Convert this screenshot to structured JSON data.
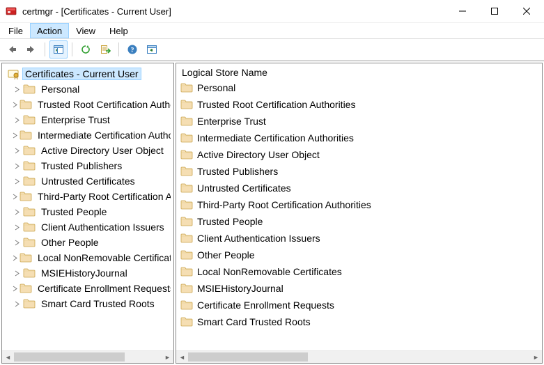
{
  "title": "certmgr - [Certificates - Current User]",
  "menu": {
    "file": "File",
    "action": "Action",
    "view": "View",
    "help": "Help"
  },
  "tree": {
    "root": "Certificates - Current User",
    "items": [
      "Personal",
      "Trusted Root Certification Authorities",
      "Enterprise Trust",
      "Intermediate Certification Authorities",
      "Active Directory User Object",
      "Trusted Publishers",
      "Untrusted Certificates",
      "Third-Party Root Certification Authorities",
      "Trusted People",
      "Client Authentication Issuers",
      "Other People",
      "Local NonRemovable Certificates",
      "MSIEHistoryJournal",
      "Certificate Enrollment Requests",
      "Smart Card Trusted Roots"
    ]
  },
  "list": {
    "header": "Logical Store Name",
    "items": [
      "Personal",
      "Trusted Root Certification Authorities",
      "Enterprise Trust",
      "Intermediate Certification Authorities",
      "Active Directory User Object",
      "Trusted Publishers",
      "Untrusted Certificates",
      "Third-Party Root Certification Authorities",
      "Trusted People",
      "Client Authentication Issuers",
      "Other People",
      "Local NonRemovable Certificates",
      "MSIEHistoryJournal",
      "Certificate Enrollment Requests",
      "Smart Card Trusted Roots"
    ]
  }
}
